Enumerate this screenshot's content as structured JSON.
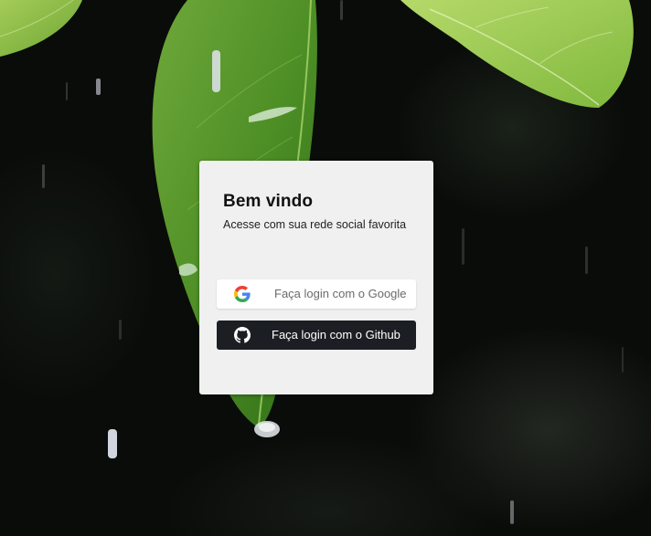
{
  "login": {
    "title": "Bem vindo",
    "subtitle": "Acesse com sua rede social favorita",
    "google_button": {
      "label": "Faça login com o Google",
      "icon": "google-icon"
    },
    "github_button": {
      "label": "Faça login com o Github",
      "icon": "github-icon"
    }
  },
  "background": {
    "description_icon": "leaves-rain-photo"
  },
  "colors": {
    "card": "#f0f0f0",
    "github_button": "#1b1f24",
    "google_button": "#ffffff"
  }
}
